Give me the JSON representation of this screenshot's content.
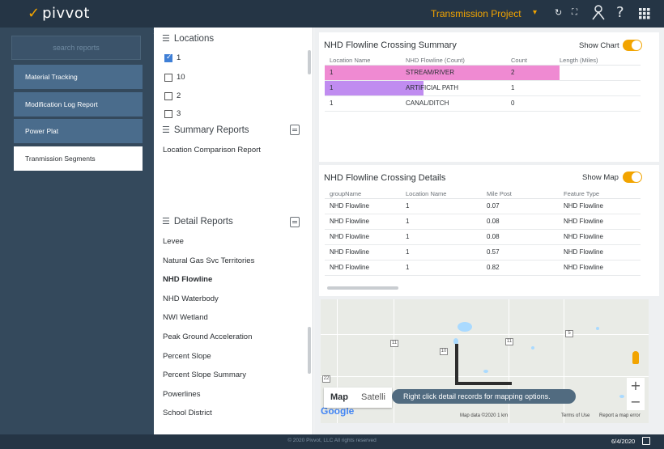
{
  "app": {
    "logo_text": "pivvot",
    "project": "Transmission Project"
  },
  "colors": {
    "brand": "#f2a400",
    "topbar": "#253545",
    "sidebar": "#34495c",
    "nav_button": "#4a6c8c",
    "highlight_pink": "#ef8ad2",
    "highlight_purple": "#c08cf0"
  },
  "topbar": {
    "icons": [
      "refresh-icon",
      "expand-icon",
      "user-icon",
      "help-icon",
      "apps-grid-icon"
    ],
    "help_label": "?"
  },
  "sidebar": {
    "search_placeholder": "search reports",
    "items": [
      {
        "label": "Material Tracking",
        "active": false
      },
      {
        "label": "Modification Log Report",
        "active": false
      },
      {
        "label": "Power Plat",
        "active": false
      },
      {
        "label": "Tranmission Segments",
        "active": true
      }
    ]
  },
  "locations": {
    "title": "Locations",
    "items": [
      {
        "label": "1",
        "checked": true
      },
      {
        "label": "10",
        "checked": false
      },
      {
        "label": "2",
        "checked": false
      },
      {
        "label": "3",
        "checked": false
      }
    ]
  },
  "summary_reports": {
    "title": "Summary Reports",
    "items": [
      "Location Comparison Report"
    ]
  },
  "detail_reports": {
    "title": "Detail Reports",
    "items": [
      "Levee",
      "Natural Gas Svc Territories",
      "NHD Flowline",
      "NHD Waterbody",
      "NWI Wetland",
      "Peak Ground Acceleration",
      "Percent Slope",
      "Percent Slope Summary",
      "Powerlines",
      "School District"
    ],
    "selected": "NHD Flowline"
  },
  "crossing_summary": {
    "title": "NHD Flowline Crossing Summary",
    "toggle_label": "Show Chart",
    "toggle_on": true,
    "columns": [
      "Location Name",
      "NHD Flowline (Count)",
      "Count",
      "Length (Miles)"
    ],
    "rows": [
      {
        "location": "1",
        "flowline": "STREAM/RIVER",
        "count": "2",
        "length": ""
      },
      {
        "location": "1",
        "flowline": "ARTIFICIAL PATH",
        "count": "1",
        "length": ""
      },
      {
        "location": "1",
        "flowline": "CANAL/DITCH",
        "count": "0",
        "length": ""
      }
    ]
  },
  "crossing_details": {
    "title": "NHD Flowline Crossing Details",
    "toggle_label": "Show Map",
    "toggle_on": true,
    "columns": [
      "groupName",
      "Location Name",
      "Mile Post",
      "Feature Type"
    ],
    "rows": [
      {
        "group": "NHD Flowline",
        "location": "1",
        "milepost": "0.07",
        "feature": "NHD Flowline"
      },
      {
        "group": "NHD Flowline",
        "location": "1",
        "milepost": "0.08",
        "feature": "NHD Flowline"
      },
      {
        "group": "NHD Flowline",
        "location": "1",
        "milepost": "0.08",
        "feature": "NHD Flowline"
      },
      {
        "group": "NHD Flowline",
        "location": "1",
        "milepost": "0.57",
        "feature": "NHD Flowline"
      },
      {
        "group": "NHD Flowline",
        "location": "1",
        "milepost": "0.82",
        "feature": "NHD Flowline"
      }
    ]
  },
  "map": {
    "type_map": "Map",
    "type_satellite": "Satelli",
    "tooltip": "Right click detail records for mapping options.",
    "google": "Google",
    "attribution": "Map data ©2020   1 km",
    "terms": "Terms of Use",
    "report": "Report a map error",
    "shields": [
      "11",
      "10",
      "11",
      "5",
      "22"
    ],
    "zoom_in": "+",
    "zoom_out": "−"
  },
  "footer": {
    "copyright": "© 2020 Pivvot, LLC All rights reserved",
    "date": "6/4/2020"
  }
}
